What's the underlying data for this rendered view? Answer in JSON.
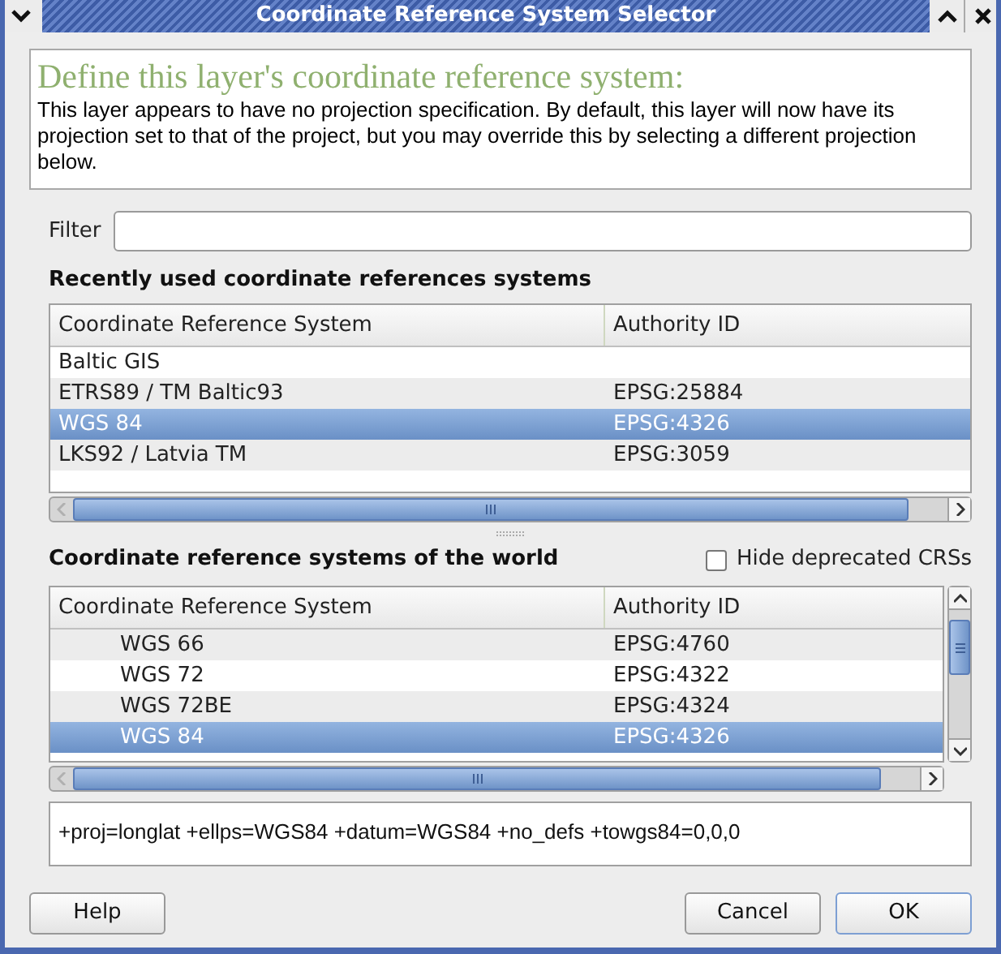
{
  "window": {
    "title": "Coordinate Reference System Selector"
  },
  "header": {
    "title": "Define this layer's coordinate reference system:",
    "description": "This layer appears to have no projection specification. By default, this layer will now have its projection set to that of the project, but you may override this by selecting a different projection below."
  },
  "filter": {
    "label": "Filter"
  },
  "recent": {
    "title": "Recently used coordinate references systems",
    "columns": [
      "Coordinate Reference System",
      "Authority ID"
    ],
    "rows": [
      {
        "name": "Baltic GIS",
        "authority": "",
        "selected": false
      },
      {
        "name": "ETRS89 / TM Baltic93",
        "authority": "EPSG:25884",
        "selected": false
      },
      {
        "name": "WGS 84",
        "authority": "EPSG:4326",
        "selected": true
      },
      {
        "name": "LKS92 / Latvia TM",
        "authority": "EPSG:3059",
        "selected": false
      }
    ]
  },
  "world": {
    "title": "Coordinate reference systems of the world",
    "hide_deprecated": {
      "label": "Hide deprecated CRSs",
      "checked": false
    },
    "columns": [
      "Coordinate Reference System",
      "Authority ID"
    ],
    "rows": [
      {
        "name": "WGS 66",
        "authority": "EPSG:4760",
        "selected": false
      },
      {
        "name": "WGS 72",
        "authority": "EPSG:4322",
        "selected": false
      },
      {
        "name": "WGS 72BE",
        "authority": "EPSG:4324",
        "selected": false
      },
      {
        "name": "WGS 84",
        "authority": "EPSG:4326",
        "selected": true
      }
    ]
  },
  "proj_string": "+proj=longlat +ellps=WGS84 +datum=WGS84 +no_defs +towgs84=0,0,0",
  "buttons": [
    {
      "label": "Help",
      "default": false
    },
    {
      "label": "Cancel",
      "default": false
    },
    {
      "label": "OK",
      "default": true
    }
  ]
}
